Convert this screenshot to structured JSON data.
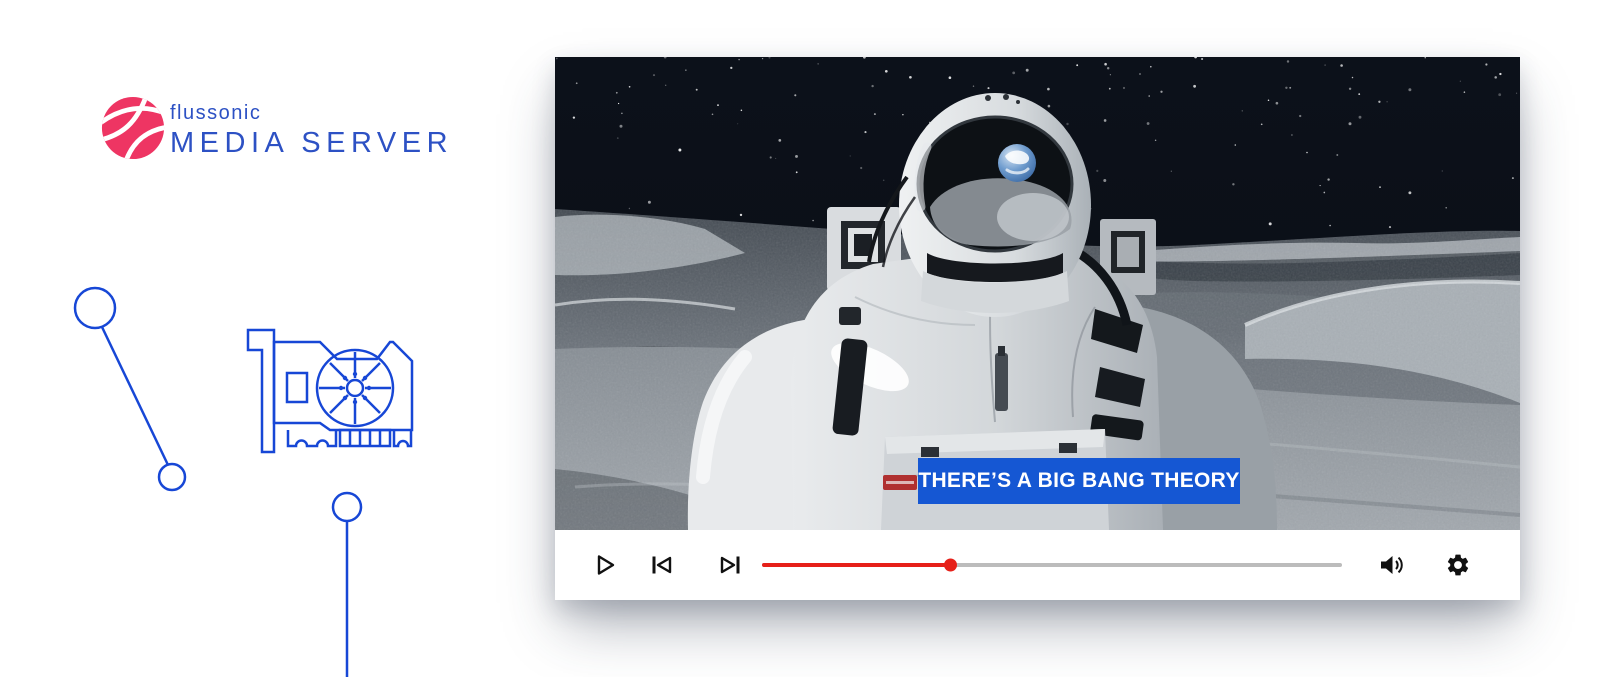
{
  "brand": {
    "line1": "flussonic",
    "line2": "MEDIA SERVER",
    "colors": {
      "pink": "#ee3563",
      "blue": "#2d51c4"
    }
  },
  "decor": {
    "blue": "#1747d6",
    "items": [
      "node-link-circles",
      "gpu-card",
      "drop-line"
    ]
  },
  "player": {
    "caption": {
      "text": "THERE’S A BIG BANG THEORY",
      "bg": "#1557d3",
      "color": "#ffffff"
    },
    "progress": {
      "percent": 32.6,
      "played_color": "#e62019",
      "track_color": "#bcbcbc"
    },
    "icons": {
      "play": "play-icon",
      "previous": "previous-icon",
      "next": "next-icon",
      "volume": "volume-icon",
      "settings": "settings-gear-icon"
    }
  }
}
